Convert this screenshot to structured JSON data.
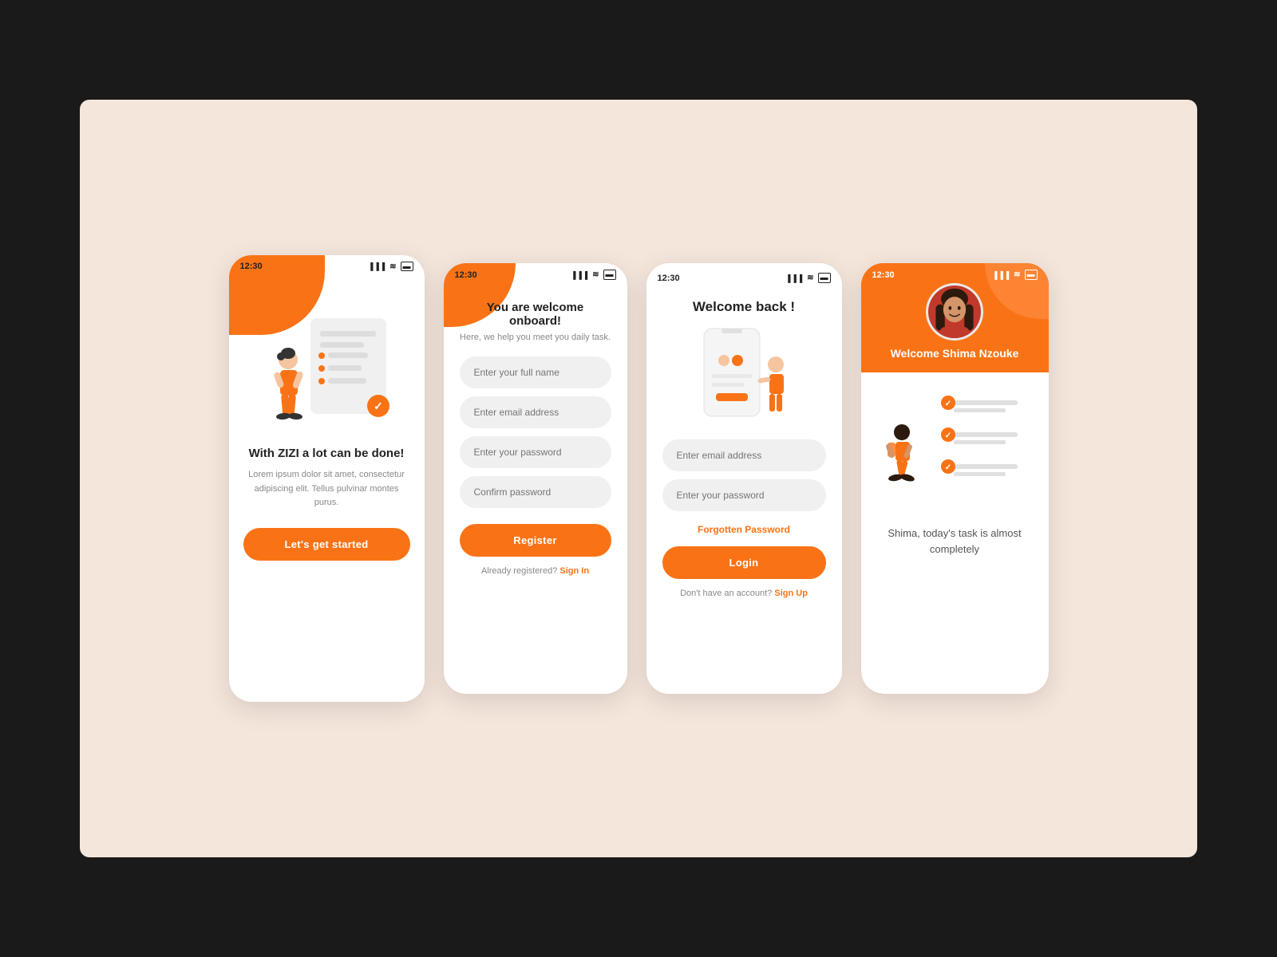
{
  "background": "#f5e6dc",
  "phone1": {
    "status_time": "12:30",
    "title": "With ZIZI a lot can be done!",
    "description": "Lorem ipsum dolor sit amet, consectetur adipiscing elit. Tellus pulvinar montes purus.",
    "cta_button": "Let's get started"
  },
  "phone2": {
    "status_time": "12:30",
    "title": "You are welcome onboard!",
    "subtitle": "Here, we help you meet you daily task.",
    "fields": [
      {
        "placeholder": "Enter your full name"
      },
      {
        "placeholder": "Enter email address"
      },
      {
        "placeholder": "Enter your password"
      },
      {
        "placeholder": "Confirm password"
      }
    ],
    "register_button": "Register",
    "already_text": "Already registered?",
    "sign_in_link": "Sign In"
  },
  "phone3": {
    "status_time": "12:30",
    "title": "Welcome back !",
    "email_placeholder": "Enter email address",
    "password_placeholder": "Enter your password",
    "forgotten_password": "Forgotten Password",
    "login_button": "Login",
    "no_account_text": "Don't have an account?",
    "sign_up_link": "Sign Up"
  },
  "phone4": {
    "status_time": "12:30",
    "welcome_name": "Welcome Shima Nzouke",
    "task_text": "Shima, today's task is almost completely"
  },
  "icons": {
    "signal": "▐▐▐",
    "wifi": "≈",
    "battery": "▭",
    "checkmark": "✓"
  }
}
